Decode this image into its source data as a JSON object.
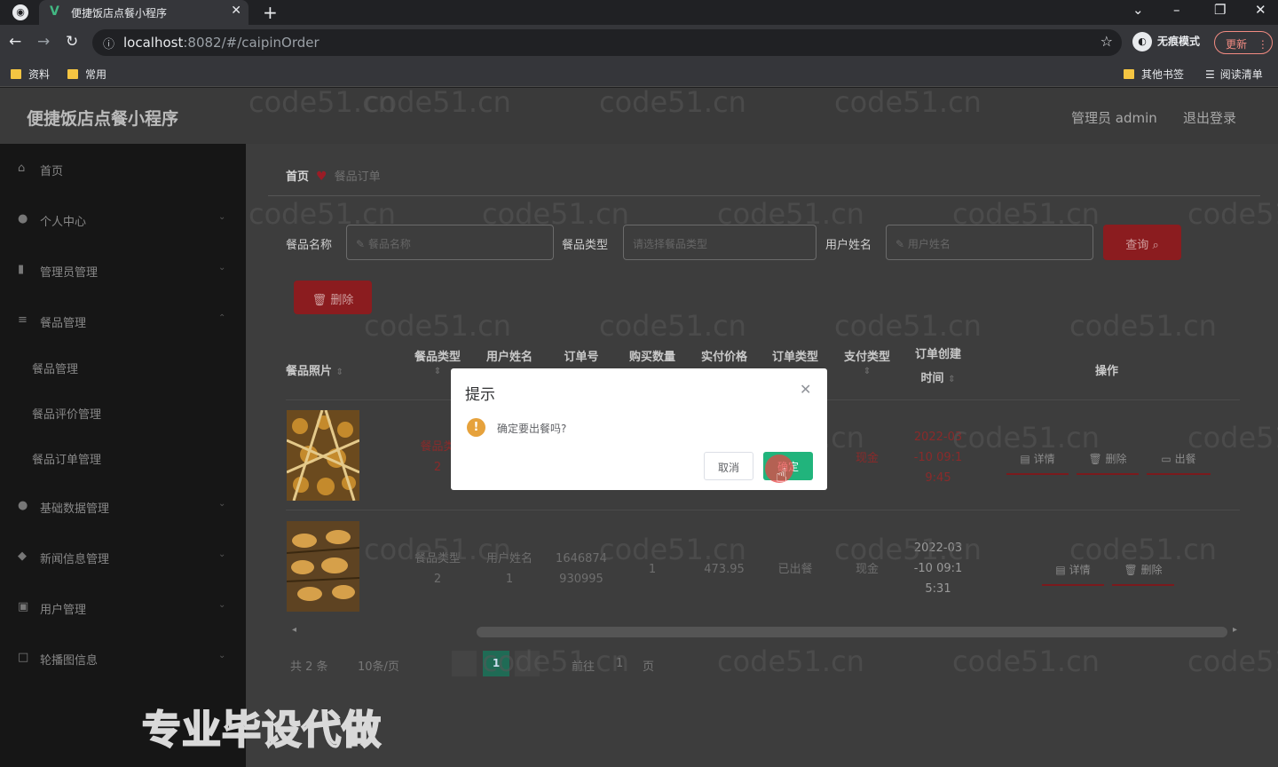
{
  "browser": {
    "tab_title": "便捷饭店点餐小程序",
    "tab_icon": "V",
    "url_host": "localhost",
    "url_rest": ":8082/#/caipinOrder",
    "incognito_label": "无痕模式",
    "update_label": "更新",
    "bookmarks": [
      "资料",
      "常用"
    ],
    "other_bookmarks": "其他书签",
    "reading_list": "阅读清单"
  },
  "header": {
    "title": "便捷饭店点餐小程序",
    "user": "管理员 admin",
    "logout": "退出登录"
  },
  "sidebar": {
    "items": [
      {
        "label": "首页",
        "icon": "home-icon"
      },
      {
        "label": "个人中心",
        "icon": "user-icon"
      },
      {
        "label": "管理员管理",
        "icon": "chart-icon"
      },
      {
        "label": "餐品管理",
        "icon": "menu-icon"
      },
      {
        "label": "基础数据管理",
        "icon": "user-icon"
      },
      {
        "label": "新闻信息管理",
        "icon": "location-icon"
      },
      {
        "label": "用户管理",
        "icon": "box-icon"
      },
      {
        "label": "轮播图信息",
        "icon": "square-icon"
      }
    ],
    "sub_items": [
      "餐品管理",
      "餐品评价管理",
      "餐品订单管理"
    ]
  },
  "breadcrumb": {
    "home": "首页",
    "current": "餐品订单"
  },
  "filters": {
    "name_label": "餐品名称",
    "name_placeholder": "餐品名称",
    "type_label": "餐品类型",
    "type_placeholder": "请选择餐品类型",
    "user_label": "用户姓名",
    "user_placeholder": "用户姓名",
    "query_button": "查询",
    "delete_button": "删除"
  },
  "table": {
    "headers": {
      "photo": "餐品照片",
      "type": "餐品类型",
      "user": "用户姓名",
      "order_no": "订单号",
      "qty": "购买数量",
      "price": "实付价格",
      "order_type": "订单类型",
      "pay_type": "支付类型",
      "created_1": "订单创建",
      "created_2": "时间",
      "ops": "操作"
    },
    "rows": [
      {
        "type_1": "餐品类",
        "type_2": "2",
        "pay": "现金",
        "created_1": "2022-03",
        "created_2": "-10 09:1",
        "created_3": "9:45",
        "ops": [
          "详情",
          "删除",
          "出餐"
        ]
      },
      {
        "type_1": "餐品类型",
        "type_2": "2",
        "user_1": "用户姓名",
        "user_2": "1",
        "order_1": "1646874",
        "order_2": "930995",
        "qty": "1",
        "price": "473.95",
        "order_type": "已出餐",
        "pay": "现金",
        "created_1": "2022-03",
        "created_2": "-10 09:1",
        "created_3": "5:31",
        "ops": [
          "详情",
          "删除"
        ]
      }
    ]
  },
  "pagination": {
    "total": "共 2 条",
    "page_size": "10条/页",
    "current": "1",
    "goto": "前往",
    "goto_value": "1",
    "page_suffix": "页"
  },
  "modal": {
    "title": "提示",
    "message": "确定要出餐吗?",
    "cancel": "取消",
    "ok": "确定"
  },
  "watermark_text": "code51.cn",
  "caption": "专业毕设代做",
  "colors": {
    "primary_red": "#8b1c1f",
    "success_green": "#21b47c",
    "warning_orange": "#e6a23c"
  }
}
